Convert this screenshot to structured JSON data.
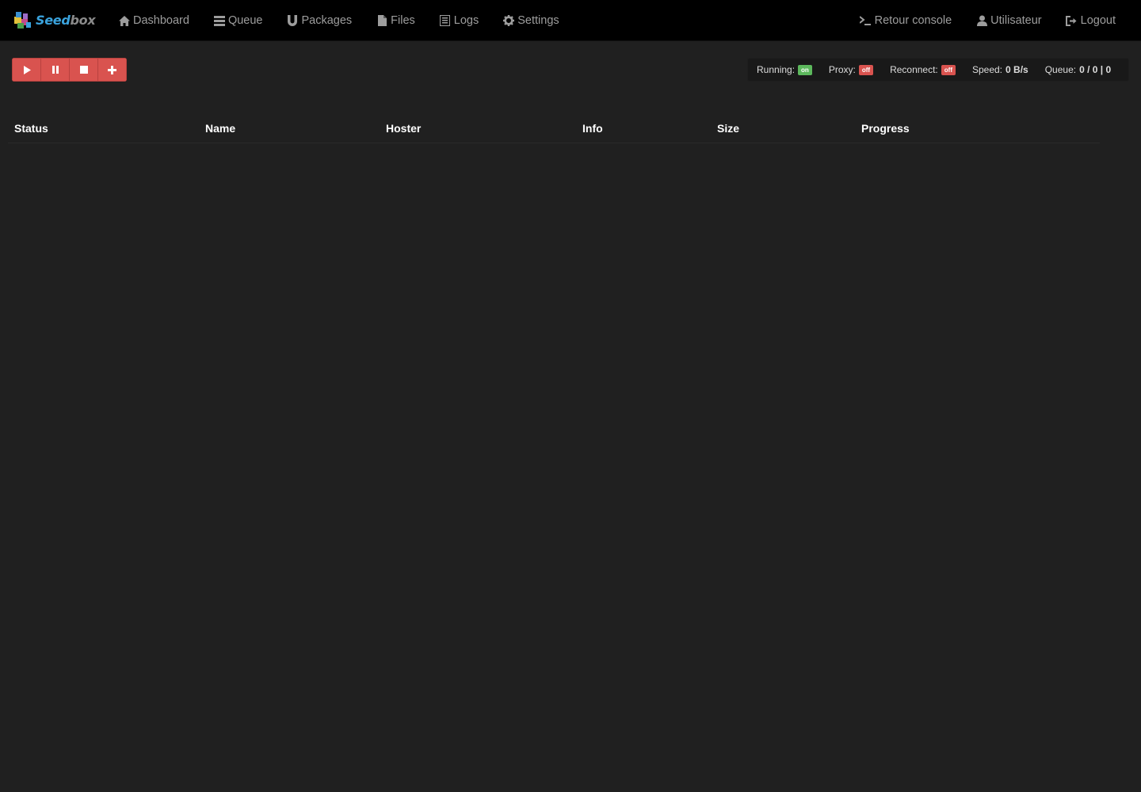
{
  "brand": {
    "seed": "Seed",
    "box": "box"
  },
  "nav": {
    "left": [
      {
        "id": "dashboard",
        "label": "Dashboard",
        "icon": "home-icon"
      },
      {
        "id": "queue",
        "label": "Queue",
        "icon": "list-icon"
      },
      {
        "id": "packages",
        "label": "Packages",
        "icon": "magnet-icon"
      },
      {
        "id": "files",
        "label": "Files",
        "icon": "file-icon"
      },
      {
        "id": "logs",
        "label": "Logs",
        "icon": "list-alt-icon"
      },
      {
        "id": "settings",
        "label": "Settings",
        "icon": "gear-icon"
      }
    ],
    "right": [
      {
        "id": "console",
        "label": "Retour console",
        "icon": "console-icon"
      },
      {
        "id": "user",
        "label": "Utilisateur",
        "icon": "user-icon"
      },
      {
        "id": "logout",
        "label": "Logout",
        "icon": "logout-icon"
      }
    ]
  },
  "toolbar": {
    "buttons": [
      {
        "id": "play",
        "icon": "play-icon"
      },
      {
        "id": "pause",
        "icon": "pause-icon"
      },
      {
        "id": "stop",
        "icon": "stop-icon"
      },
      {
        "id": "add",
        "icon": "plus-icon"
      }
    ]
  },
  "status": {
    "running_label": "Running:",
    "running_value": "on",
    "proxy_label": "Proxy:",
    "proxy_value": "off",
    "reconnect_label": "Reconnect:",
    "reconnect_value": "off",
    "speed_label": "Speed:",
    "speed_value": "0 B/s",
    "queue_label": "Queue:",
    "queue_value": "0 / 0 | 0"
  },
  "table": {
    "headers": [
      "Status",
      "Name",
      "Hoster",
      "Info",
      "Size",
      "Progress"
    ]
  },
  "colors": {
    "background": "#202020",
    "navbar": "#000000",
    "danger": "#d9534f",
    "success": "#5cb85c",
    "brand_blue": "#3aa3dd"
  }
}
